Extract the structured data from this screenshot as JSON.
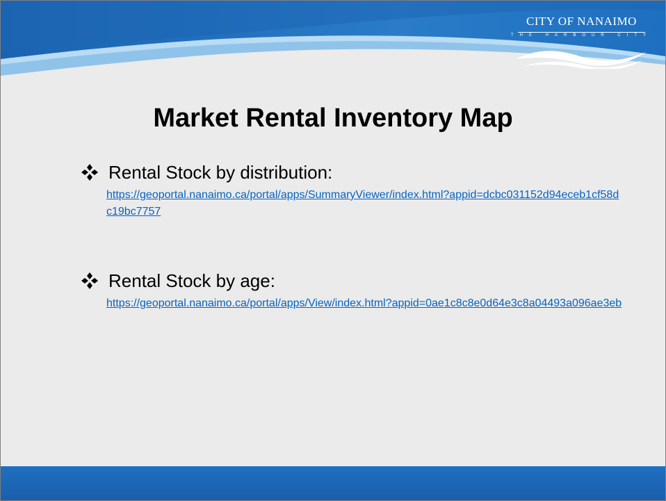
{
  "logo": {
    "title": "CITY OF NANAIMO",
    "subtitle": "THE HARBOUR CITY"
  },
  "slide": {
    "title": "Market Rental Inventory Map",
    "bullets": [
      {
        "label": "Rental Stock by distribution:",
        "link": "https://geoportal.nanaimo.ca/portal/apps/SummaryViewer/index.html?appid=dcbc031152d94eceb1cf58dc19bc7757"
      },
      {
        "label": "Rental Stock by age:",
        "link": "https://geoportal.nanaimo.ca/portal/apps/View/index.html?appid=0ae1c8c8e0d64e3c8a04493a096ae3eb"
      }
    ]
  },
  "icons": {
    "bullet": "four-diamond-bullet-icon"
  },
  "colors": {
    "header_blue": "#1f6fc0",
    "header_light": "#9ec9ec",
    "background": "#ebebeb",
    "link": "#0563c1",
    "footer_blue": "#1f6fc0"
  }
}
